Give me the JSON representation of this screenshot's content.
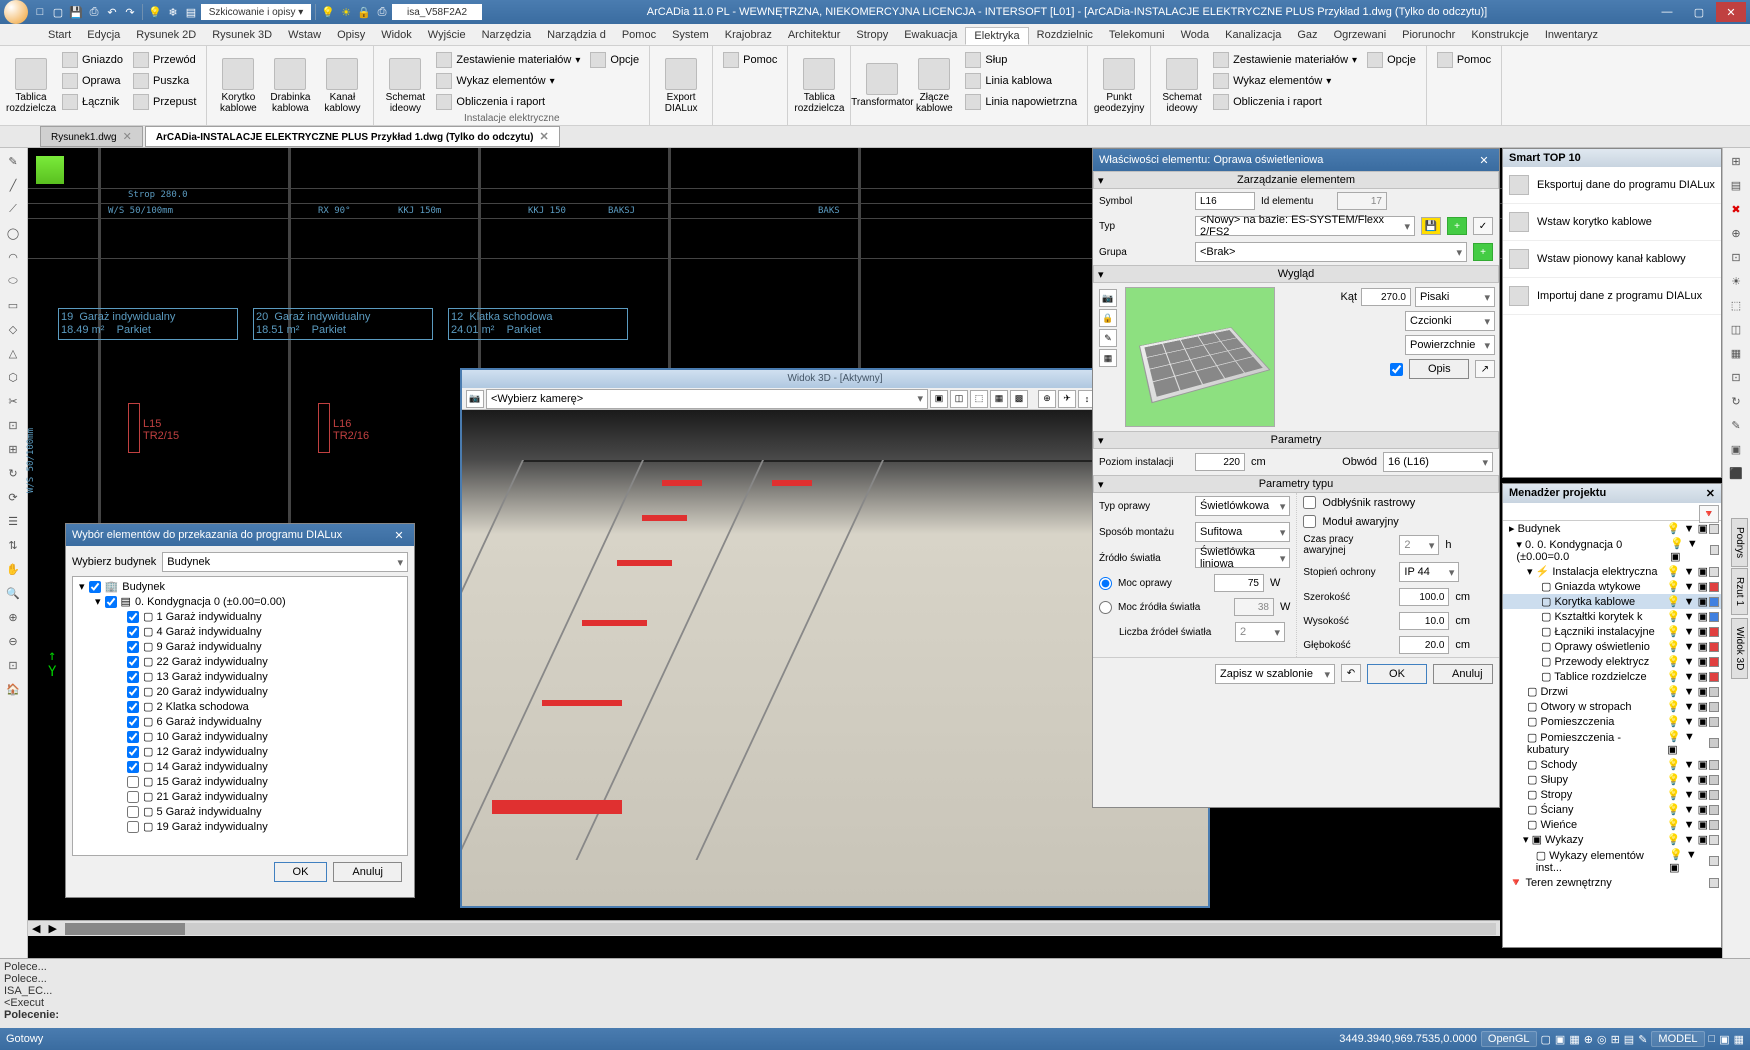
{
  "titlebar": {
    "qat_layer_combo": "isa_V58F2A2",
    "title": "ArCADia 11.0 PL - WEWNĘTRZNA, NIEKOMERCYJNA LICENCJA - INTERSOFT [L01] - [ArCADia-INSTALACJE ELEKTRYCZNE PLUS Przykład 1.dwg (Tylko do odczytu)]"
  },
  "menu": [
    "Start",
    "Edycja",
    "Rysunek 2D",
    "Rysunek 3D",
    "Wstaw",
    "Opisy",
    "Widok",
    "Wyjście",
    "Narzędzia",
    "Narządzia d",
    "Pomoc",
    "System",
    "Krajobraz",
    "Architektur",
    "Stropy",
    "Ewakuacja",
    "Elektryka",
    "Rozdzielnic",
    "Telekomuni",
    "Woda",
    "Kanalizacja",
    "Gaz",
    "Ogrzewani",
    "Piorunochr",
    "Konstrukcje",
    "Inwentaryz"
  ],
  "ribbon": {
    "groups": [
      {
        "big": [
          {
            "label": "Tablica\nrozdzielcza"
          }
        ],
        "small": [
          [
            "Gniazdo",
            "Oprawa",
            "Łącznik"
          ],
          [
            "Przewód",
            "Puszka",
            "Przepust"
          ]
        ],
        "label": ""
      },
      {
        "big": [
          {
            "label": "Korytko\nkablowe"
          },
          {
            "label": "Drabinka\nkablowa"
          },
          {
            "label": "Kanał\nkablowy"
          }
        ],
        "label": ""
      },
      {
        "big": [
          {
            "label": "Schemat\nideowy"
          }
        ],
        "small": [
          [
            "Zestawienie materiałów",
            "Wykaz elementów",
            "Obliczenia i raport"
          ]
        ],
        "opts": true,
        "label": "Instalacje elektryczne"
      },
      {
        "big": [
          {
            "label": "Export\nDIALux"
          }
        ],
        "label": ""
      },
      {
        "big": [],
        "small": [
          [
            "Pomoc"
          ]
        ],
        "label": ""
      },
      {
        "big": [
          {
            "label": "Tablica\nrozdzielcza"
          }
        ],
        "label": ""
      },
      {
        "big": [
          {
            "label": "Transformator"
          },
          {
            "label": "Złącze\nkablowe"
          }
        ],
        "small": [
          [
            "Słup",
            "Linia kablowa",
            "Linia napowietrzna"
          ]
        ],
        "label": ""
      },
      {
        "big": [
          {
            "label": "Punkt\ngeodezyjny"
          }
        ],
        "label": ""
      },
      {
        "big": [
          {
            "label": "Schemat\nideowy"
          }
        ],
        "small": [
          [
            "Zestawienie materiałów",
            "Wykaz elementów",
            "Obliczenia i raport"
          ]
        ],
        "opts": true,
        "label": ""
      },
      {
        "big": [],
        "small": [
          [
            "Pomoc"
          ]
        ],
        "label": ""
      }
    ]
  },
  "doctabs": [
    {
      "label": "Rysunek1.dwg",
      "active": false
    },
    {
      "label": "ArCADia-INSTALACJE ELEKTRYCZNE PLUS Przykład 1.dwg (Tylko do odczytu)",
      "active": true
    }
  ],
  "cad": {
    "top_labels": [
      "Strop 280.0",
      "W/S 50/100mm",
      "RX   90°",
      "KKJ 150m",
      "KKJ 150",
      "BAKSJ",
      "BAKS",
      "W/S"
    ],
    "rooms": [
      {
        "num": "19",
        "name": "Garaż indywidualny",
        "area": "18.49 m²",
        "floor": "Parkiet"
      },
      {
        "num": "20",
        "name": "Garaż indywidualny",
        "area": "18.51 m²",
        "floor": "Parkiet"
      },
      {
        "num": "12",
        "name": "Klatka schodowa",
        "area": "24.01 m²",
        "floor": "Parkiet"
      }
    ],
    "fixtures": [
      {
        "id": "L15",
        "ref": "TR2/15"
      },
      {
        "id": "L16",
        "ref": "TR2/16"
      }
    ],
    "axis": "W/S 50/100mm"
  },
  "dialux_dlg": {
    "title": "Wybór elementów do przekazania do programu DIALux",
    "select_label": "Wybierz budynek",
    "select_value": "Budynek",
    "root": "Budynek",
    "level": "0. Kondygnacja 0 (±0.00=0.00)",
    "items": [
      {
        "c": true,
        "t": "1 Garaż indywidualny"
      },
      {
        "c": true,
        "t": "4 Garaż indywidualny"
      },
      {
        "c": true,
        "t": "9 Garaż indywidualny"
      },
      {
        "c": true,
        "t": "22 Garaż indywidualny"
      },
      {
        "c": true,
        "t": "13 Garaż indywidualny"
      },
      {
        "c": true,
        "t": "20 Garaż indywidualny"
      },
      {
        "c": true,
        "t": "2 Klatka schodowa"
      },
      {
        "c": true,
        "t": "6 Garaż indywidualny"
      },
      {
        "c": true,
        "t": "10 Garaż indywidualny"
      },
      {
        "c": true,
        "t": "12 Garaż indywidualny"
      },
      {
        "c": true,
        "t": "14 Garaż indywidualny"
      },
      {
        "c": false,
        "t": "15 Garaż indywidualny"
      },
      {
        "c": false,
        "t": "21 Garaż indywidualny"
      },
      {
        "c": false,
        "t": "5 Garaż indywidualny"
      },
      {
        "c": false,
        "t": "19 Garaż indywidualny"
      }
    ],
    "ok": "OK",
    "cancel": "Anuluj"
  },
  "view3d": {
    "title": "Widok 3D - [Aktywny]",
    "cam": "<Wybierz kamerę>"
  },
  "props": {
    "title": "Właściwości elementu: Oprawa oświetleniowa",
    "sec_mgmt": "Zarządzanie elementem",
    "symbol_l": "Symbol",
    "symbol_v": "L16",
    "id_l": "Id elementu",
    "id_v": "17",
    "type_l": "Typ",
    "type_v": "<Nowy> na bazie: ES-SYSTEM/Flexx 2/FS2",
    "group_l": "Grupa",
    "group_v": "<Brak>",
    "sec_look": "Wygląd",
    "angle_l": "Kąt",
    "angle_v": "270.0",
    "pens": "Pisaki",
    "fonts": "Czcionki",
    "surfaces": "Powierzchnie",
    "desc": "Opis",
    "sec_params": "Parametry",
    "level_l": "Poziom instalacji",
    "level_v": "220",
    "level_u": "cm",
    "circuit_l": "Obwód",
    "circuit_v": "16 (L16)",
    "sec_typeparams": "Parametry typu",
    "fixtype_l": "Typ oprawy",
    "fixtype_v": "Świetlówkowa",
    "mount_l": "Sposób montażu",
    "mount_v": "Sufitowa",
    "light_l": "Źródło światła",
    "light_v": "Świetlówka liniowa",
    "raster_l": "Odbłyśnik rastrowy",
    "emerg_l": "Moduł awaryjny",
    "power_l": "Moc oprawy",
    "power_v": "75",
    "power_u": "W",
    "srcpower_l": "Moc źródła światła",
    "srcpower_v": "38",
    "srcpower_u": "W",
    "srccount_l": "Liczba źródeł światła",
    "srccount_v": "2",
    "worktime_l": "Czas pracy awaryjnej",
    "worktime_v": "2",
    "worktime_u": "h",
    "ip_l": "Stopień ochrony",
    "ip_v": "IP 44",
    "width_l": "Szerokość",
    "width_v": "100.0",
    "width_u": "cm",
    "height_l": "Wysokość",
    "height_v": "10.0",
    "height_u": "cm",
    "depth_l": "Głębokość",
    "depth_v": "20.0",
    "depth_u": "cm",
    "save_tpl": "Zapisz w szablonie",
    "ok": "OK",
    "cancel": "Anuluj"
  },
  "smart": {
    "title": "Smart TOP 10",
    "items": [
      "Eksportuj dane do programu DIALux",
      "Wstaw korytko kablowe",
      "Wstaw pionowy kanał kablowy",
      "Importuj dane z programu DIALux"
    ]
  },
  "projmgr": {
    "title": "Menadżer projektu",
    "root": "Budynek",
    "level": "0. Kondygnacja 0 (±0.00=0.0",
    "elec": "Instalacja elektryczna",
    "items": [
      {
        "t": "Gniazda wtykowe",
        "c": "#e04040"
      },
      {
        "t": "Korytka kablowe",
        "c": "#4080e0",
        "sel": true
      },
      {
        "t": "Kształtki korytek k",
        "c": "#4080e0"
      },
      {
        "t": "Łączniki instalacyjne",
        "c": "#e04040"
      },
      {
        "t": "Oprawy oświetlenio",
        "c": "#e04040"
      },
      {
        "t": "Przewody elektrycz",
        "c": "#e04040"
      },
      {
        "t": "Tablice rozdzielcze",
        "c": "#e04040"
      }
    ],
    "other": [
      {
        "t": "Drzwi"
      },
      {
        "t": "Otwory w stropach"
      },
      {
        "t": "Pomieszczenia"
      },
      {
        "t": "Pomieszczenia - kubatury"
      },
      {
        "t": "Schody"
      },
      {
        "t": "Słupy"
      },
      {
        "t": "Stropy"
      },
      {
        "t": "Ściany"
      },
      {
        "t": "Wieńce"
      }
    ],
    "wykazy": "Wykazy",
    "wykazy_item": "Wykazy elementów inst...",
    "teren": "Teren zewnętrzny"
  },
  "cmd": {
    "lines": [
      "Polece...",
      "Polece...",
      "ISA_EC...",
      "<Execut"
    ],
    "prompt": "Polecenie:"
  },
  "status": {
    "ready": "Gotowy",
    "coords": "3449.3940,969.7535,0.0000",
    "ogl": "OpenGL",
    "model": "MODEL"
  },
  "side_tabs": {
    "p": "Podrys",
    "r": "Rzut 1",
    "w": "Widok 3D"
  }
}
